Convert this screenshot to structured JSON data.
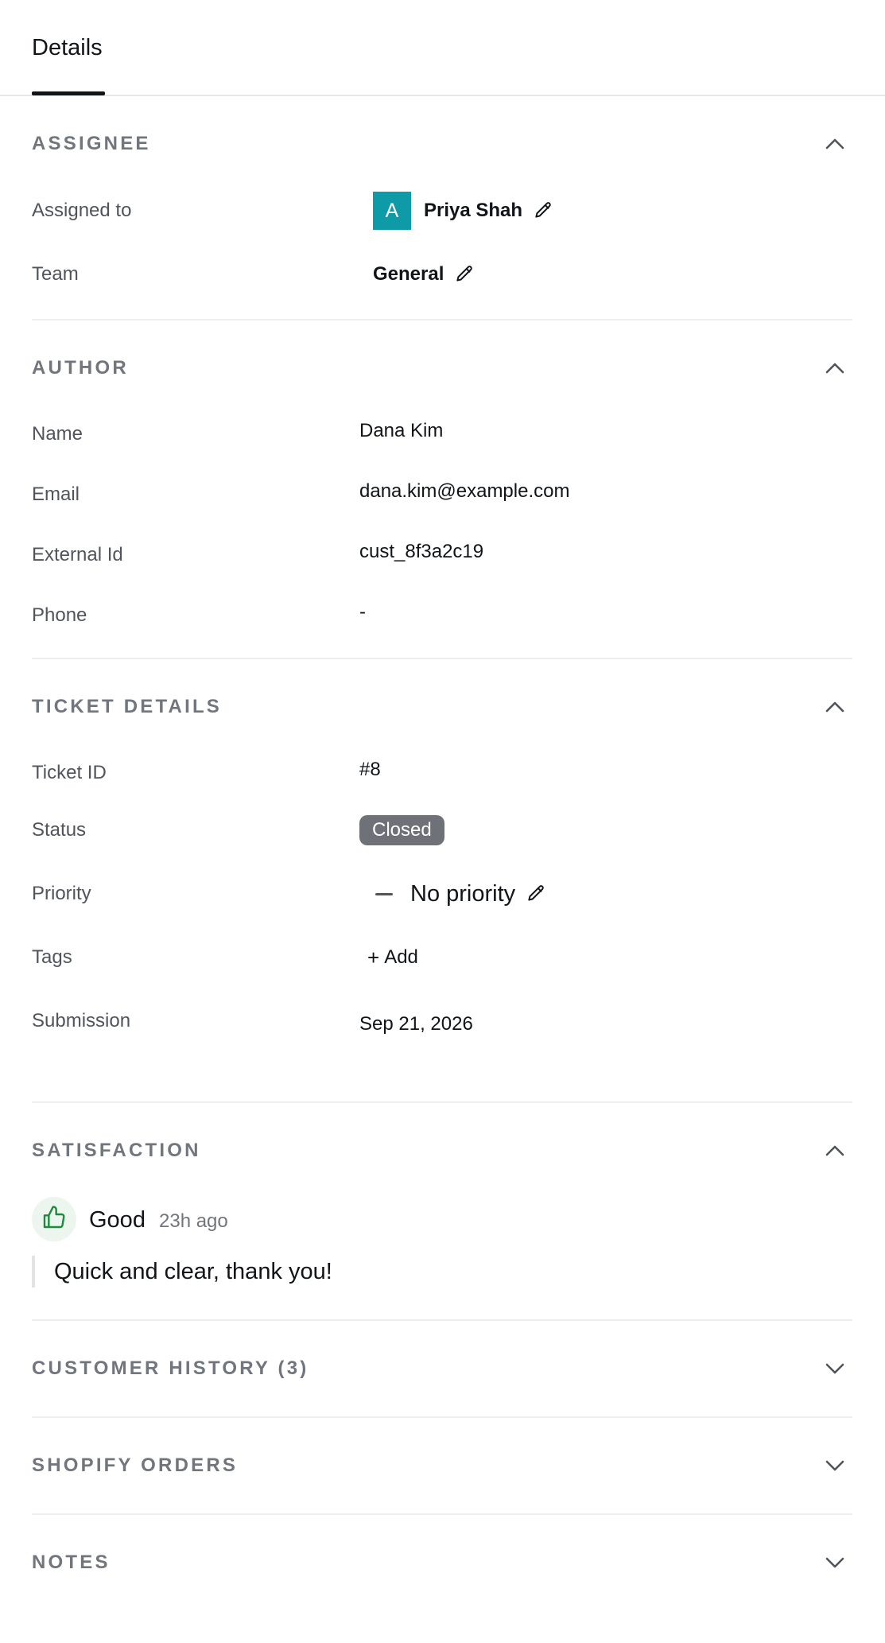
{
  "tabs": [
    {
      "label": "Details",
      "active": true
    }
  ],
  "assignee": {
    "title": "ASSIGNEE",
    "expanded": true,
    "assigned_to_label": "Assigned to",
    "avatar_letter": "A",
    "avatar_color": "#0f9aa8",
    "assigned_to_value": "Priya Shah",
    "team_label": "Team",
    "team_value": "General"
  },
  "author": {
    "title": "AUTHOR",
    "expanded": true,
    "fields": [
      {
        "label": "Name",
        "value": "Dana Kim"
      },
      {
        "label": "Email",
        "value": "dana.kim@example.com"
      },
      {
        "label": "External Id",
        "value": "cust_8f3a2c19"
      },
      {
        "label": "Phone",
        "value": "-"
      }
    ]
  },
  "ticket_details": {
    "title": "TICKET DETAILS",
    "expanded": true,
    "ticket_id_label": "Ticket ID",
    "ticket_id_value": "#8",
    "status_label": "Status",
    "status_value": "Closed",
    "status_color": "#6f7178",
    "priority_label": "Priority",
    "priority_value": "No priority",
    "tags_label": "Tags",
    "tags_add_label": "Add",
    "submission_label": "Submission",
    "submission_value": "Sep 21, 2026"
  },
  "satisfaction": {
    "title": "SATISFACTION",
    "expanded": true,
    "rating": "Good",
    "time_ago": "23h ago",
    "comment": "Quick and clear, thank you!",
    "icon": "thumbs-up-icon",
    "icon_color": "#1e8a3c"
  },
  "collapsed_sections": [
    {
      "title": "CUSTOMER HISTORY (3)",
      "expanded": false
    },
    {
      "title": "SHOPIFY ORDERS",
      "expanded": false
    },
    {
      "title": "NOTES",
      "expanded": false
    }
  ]
}
